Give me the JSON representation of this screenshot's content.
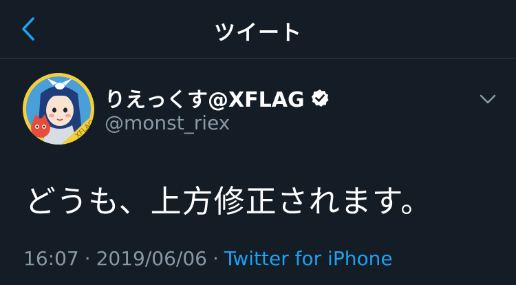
{
  "nav": {
    "title": "ツイート",
    "back_icon": "chevron-left-icon",
    "accent_color": "#1da1f2"
  },
  "tweet": {
    "author": {
      "display_name": "りえっくす@XFLAG",
      "handle": "@monst_riex",
      "verified": true,
      "avatar_text": "XFLAG"
    },
    "text": "どうも、上方修正されます。",
    "time": "16:07",
    "date": "2019/06/06",
    "separator": "·",
    "source": "Twitter for iPhone",
    "menu_icon": "chevron-down-icon"
  },
  "colors": {
    "background": "#141d26",
    "secondary_text": "#8899a6",
    "link": "#1da1f2"
  }
}
